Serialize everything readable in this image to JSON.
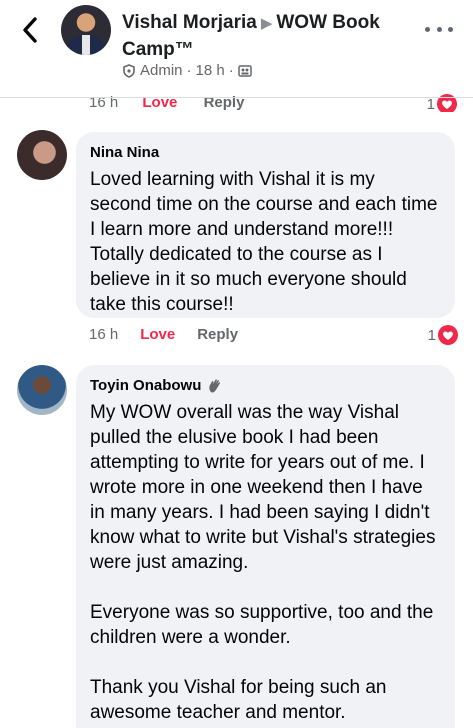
{
  "header": {
    "post_author": "Vishal Morjaria",
    "group_name": "WOW Book Camp™",
    "role": "Admin",
    "time": "18 h",
    "separator": "·"
  },
  "previous_comment": {
    "time": "16 h",
    "love_label": "Love",
    "reply_label": "Reply",
    "reaction_count": "1"
  },
  "comments": [
    {
      "author": "Nina Nina",
      "paragraphs": [
        "Loved learning with Vishal it is my second time on the course and each time I learn more and understand more!!! Totally dedicated to the course as I believe in it so much everyone should take this course!!"
      ],
      "time": "16 h",
      "love_label": "Love",
      "reply_label": "Reply",
      "reaction_count": "1"
    },
    {
      "author": "Toyin Onabowu",
      "paragraphs": [
        "My WOW overall was the way Vishal pulled the elusive book I had been attempting to write for years out of me. I wrote more in one weekend then I have in many years. I had been saying I didn't know what to write but Vishal's strategies were just amazing.",
        "Everyone was so supportive, too and the children were a wonder.",
        "Thank you Vishal for being such an awesome teacher and mentor."
      ]
    }
  ],
  "icons": {
    "back": "chevron-left-icon",
    "more": "more-icon",
    "admin": "shield-icon",
    "audience": "group-icon",
    "heart": "heart-reaction-icon",
    "badge": "wave-hand-icon"
  },
  "colors": {
    "love": "#f0284a",
    "bubble": "#f0f2f5",
    "secondary_text": "#65676b"
  }
}
